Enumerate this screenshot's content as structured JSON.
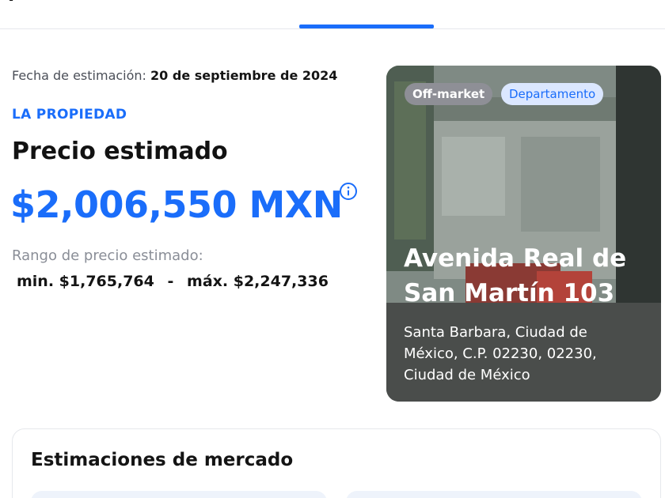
{
  "header": {
    "tab_fragment": "P"
  },
  "estimate": {
    "date_label": "Fecha de estimación:",
    "date_value": "20 de septiembre de 2024",
    "section_kicker": "LA PROPIEDAD",
    "heading": "Precio estimado",
    "price": "$2,006,550 MXN",
    "range_label": "Rango de precio estimado:",
    "range_min": "min. $1,765,764",
    "range_sep": "-",
    "range_max": "máx. $2,247,336",
    "info_icon": "info-circle-icon"
  },
  "property": {
    "badge_status": "Off-market",
    "badge_type": "Departamento",
    "title": "Avenida Real de San Martín 103",
    "address": "Santa Barbara, Ciudad de México, C.P. 02230, 02230, Ciudad de México"
  },
  "market": {
    "title": "Estimaciones de mercado"
  },
  "colors": {
    "accent": "#1a6dfa",
    "badge_status_bg": "#8e8f96",
    "badge_type_bg": "#dbe7ff"
  }
}
